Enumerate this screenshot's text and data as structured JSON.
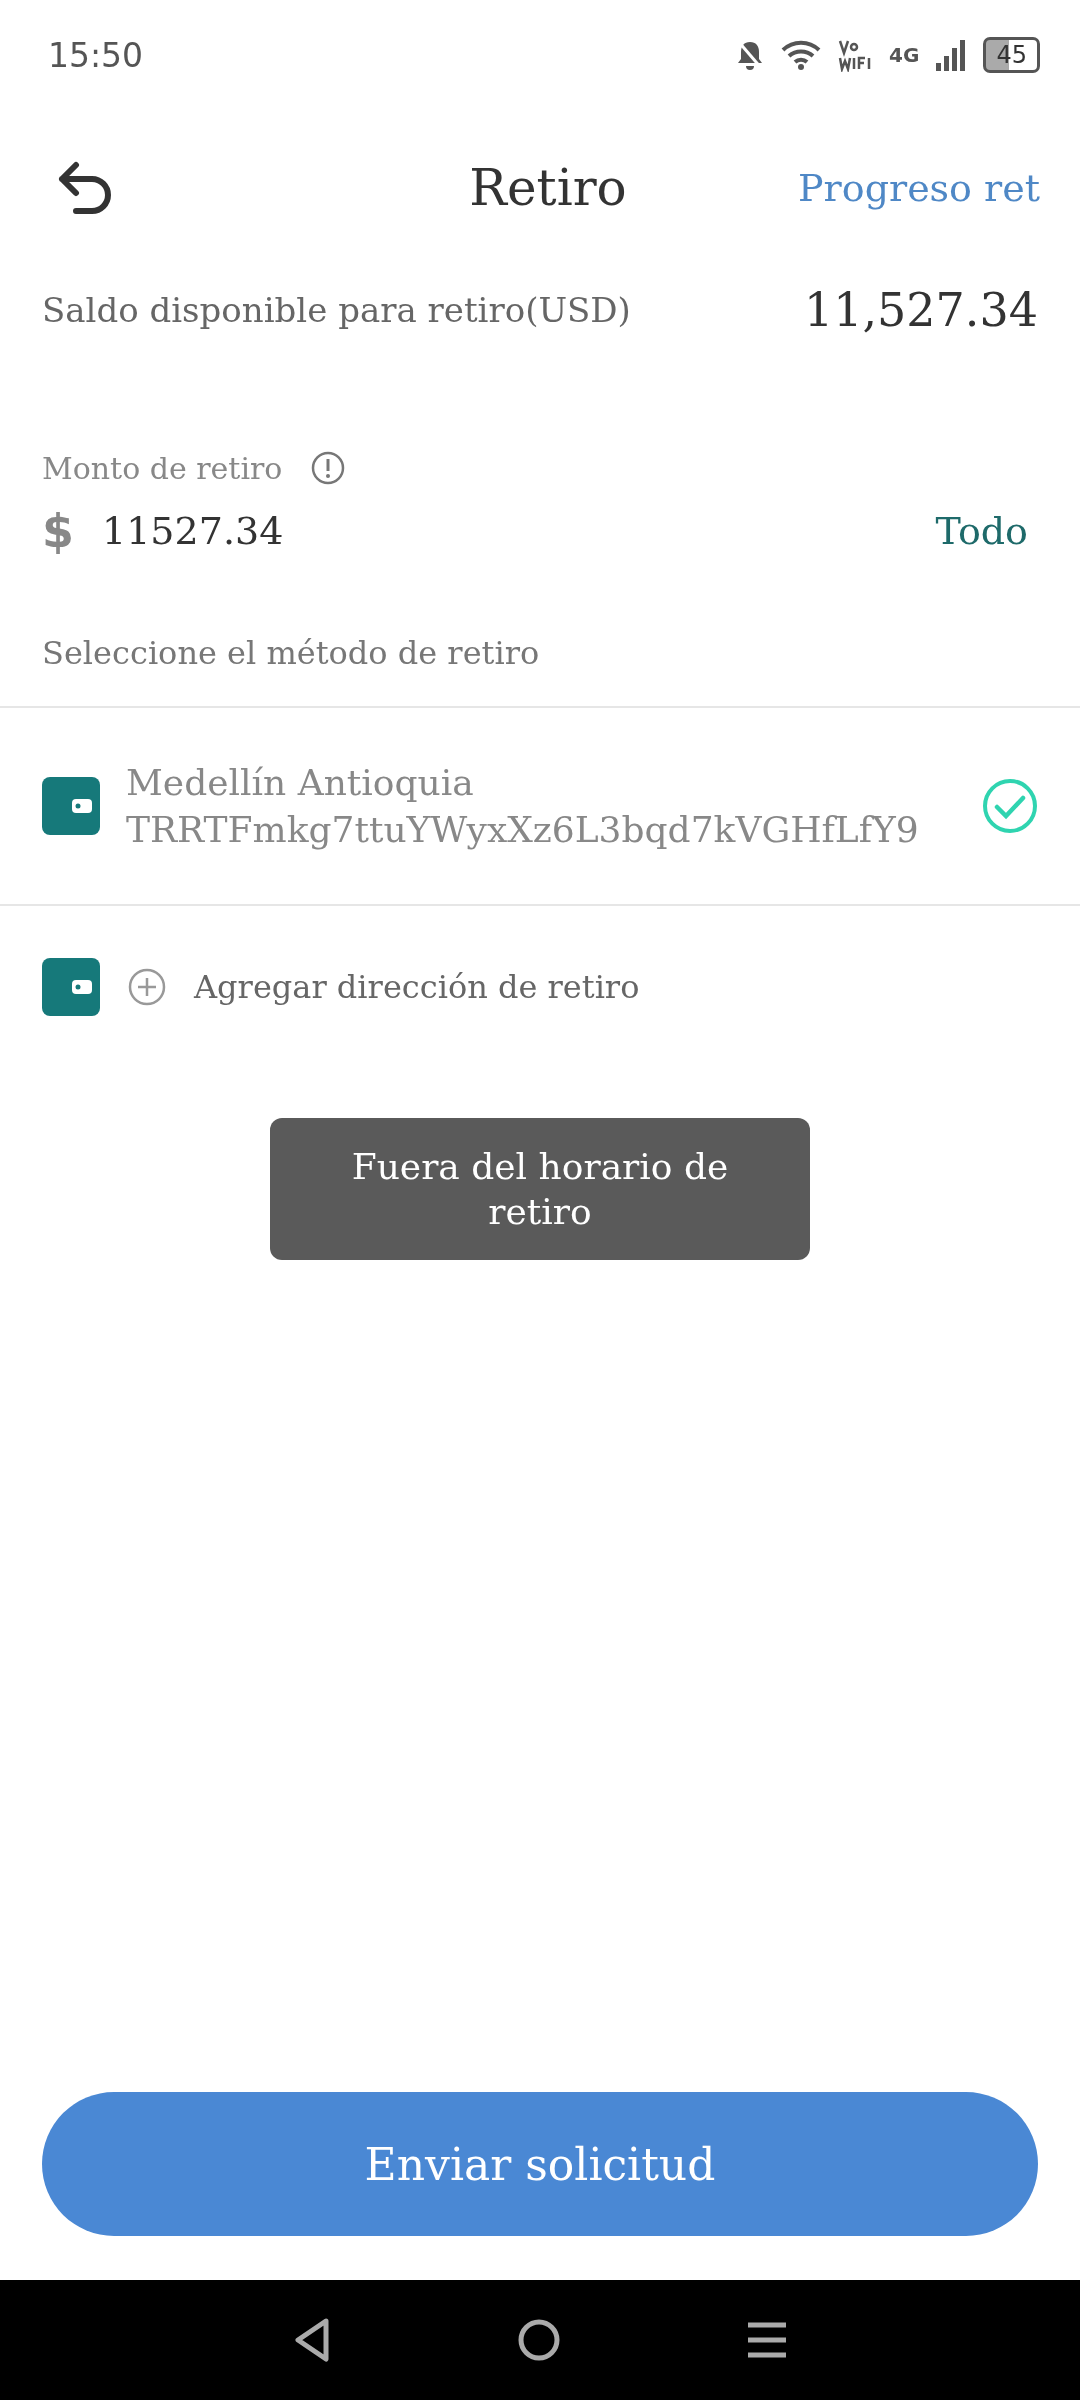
{
  "status_bar": {
    "time": "15:50",
    "network": "4G",
    "battery": "45"
  },
  "header": {
    "title": "Retiro",
    "action": "Progreso ret"
  },
  "balance": {
    "label": "Saldo disponible para retiro(USD)",
    "value": "11,527.34"
  },
  "amount": {
    "label": "Monto de retiro",
    "currency": "$",
    "value": "11527.34",
    "all_button": "Todo"
  },
  "method_section": {
    "label": "Seleccione el método de retiro",
    "methods": [
      {
        "name": "Medellín Antioquia",
        "address": "TRRTFmkg7ttuYWyxXz6L3bqd7kVGHfLfY9",
        "selected": true
      }
    ],
    "add_label": "Agregar dirección de retiro"
  },
  "toast": {
    "text": "Fuera del horario de retiro"
  },
  "submit": {
    "label": "Enviar solicitud"
  }
}
